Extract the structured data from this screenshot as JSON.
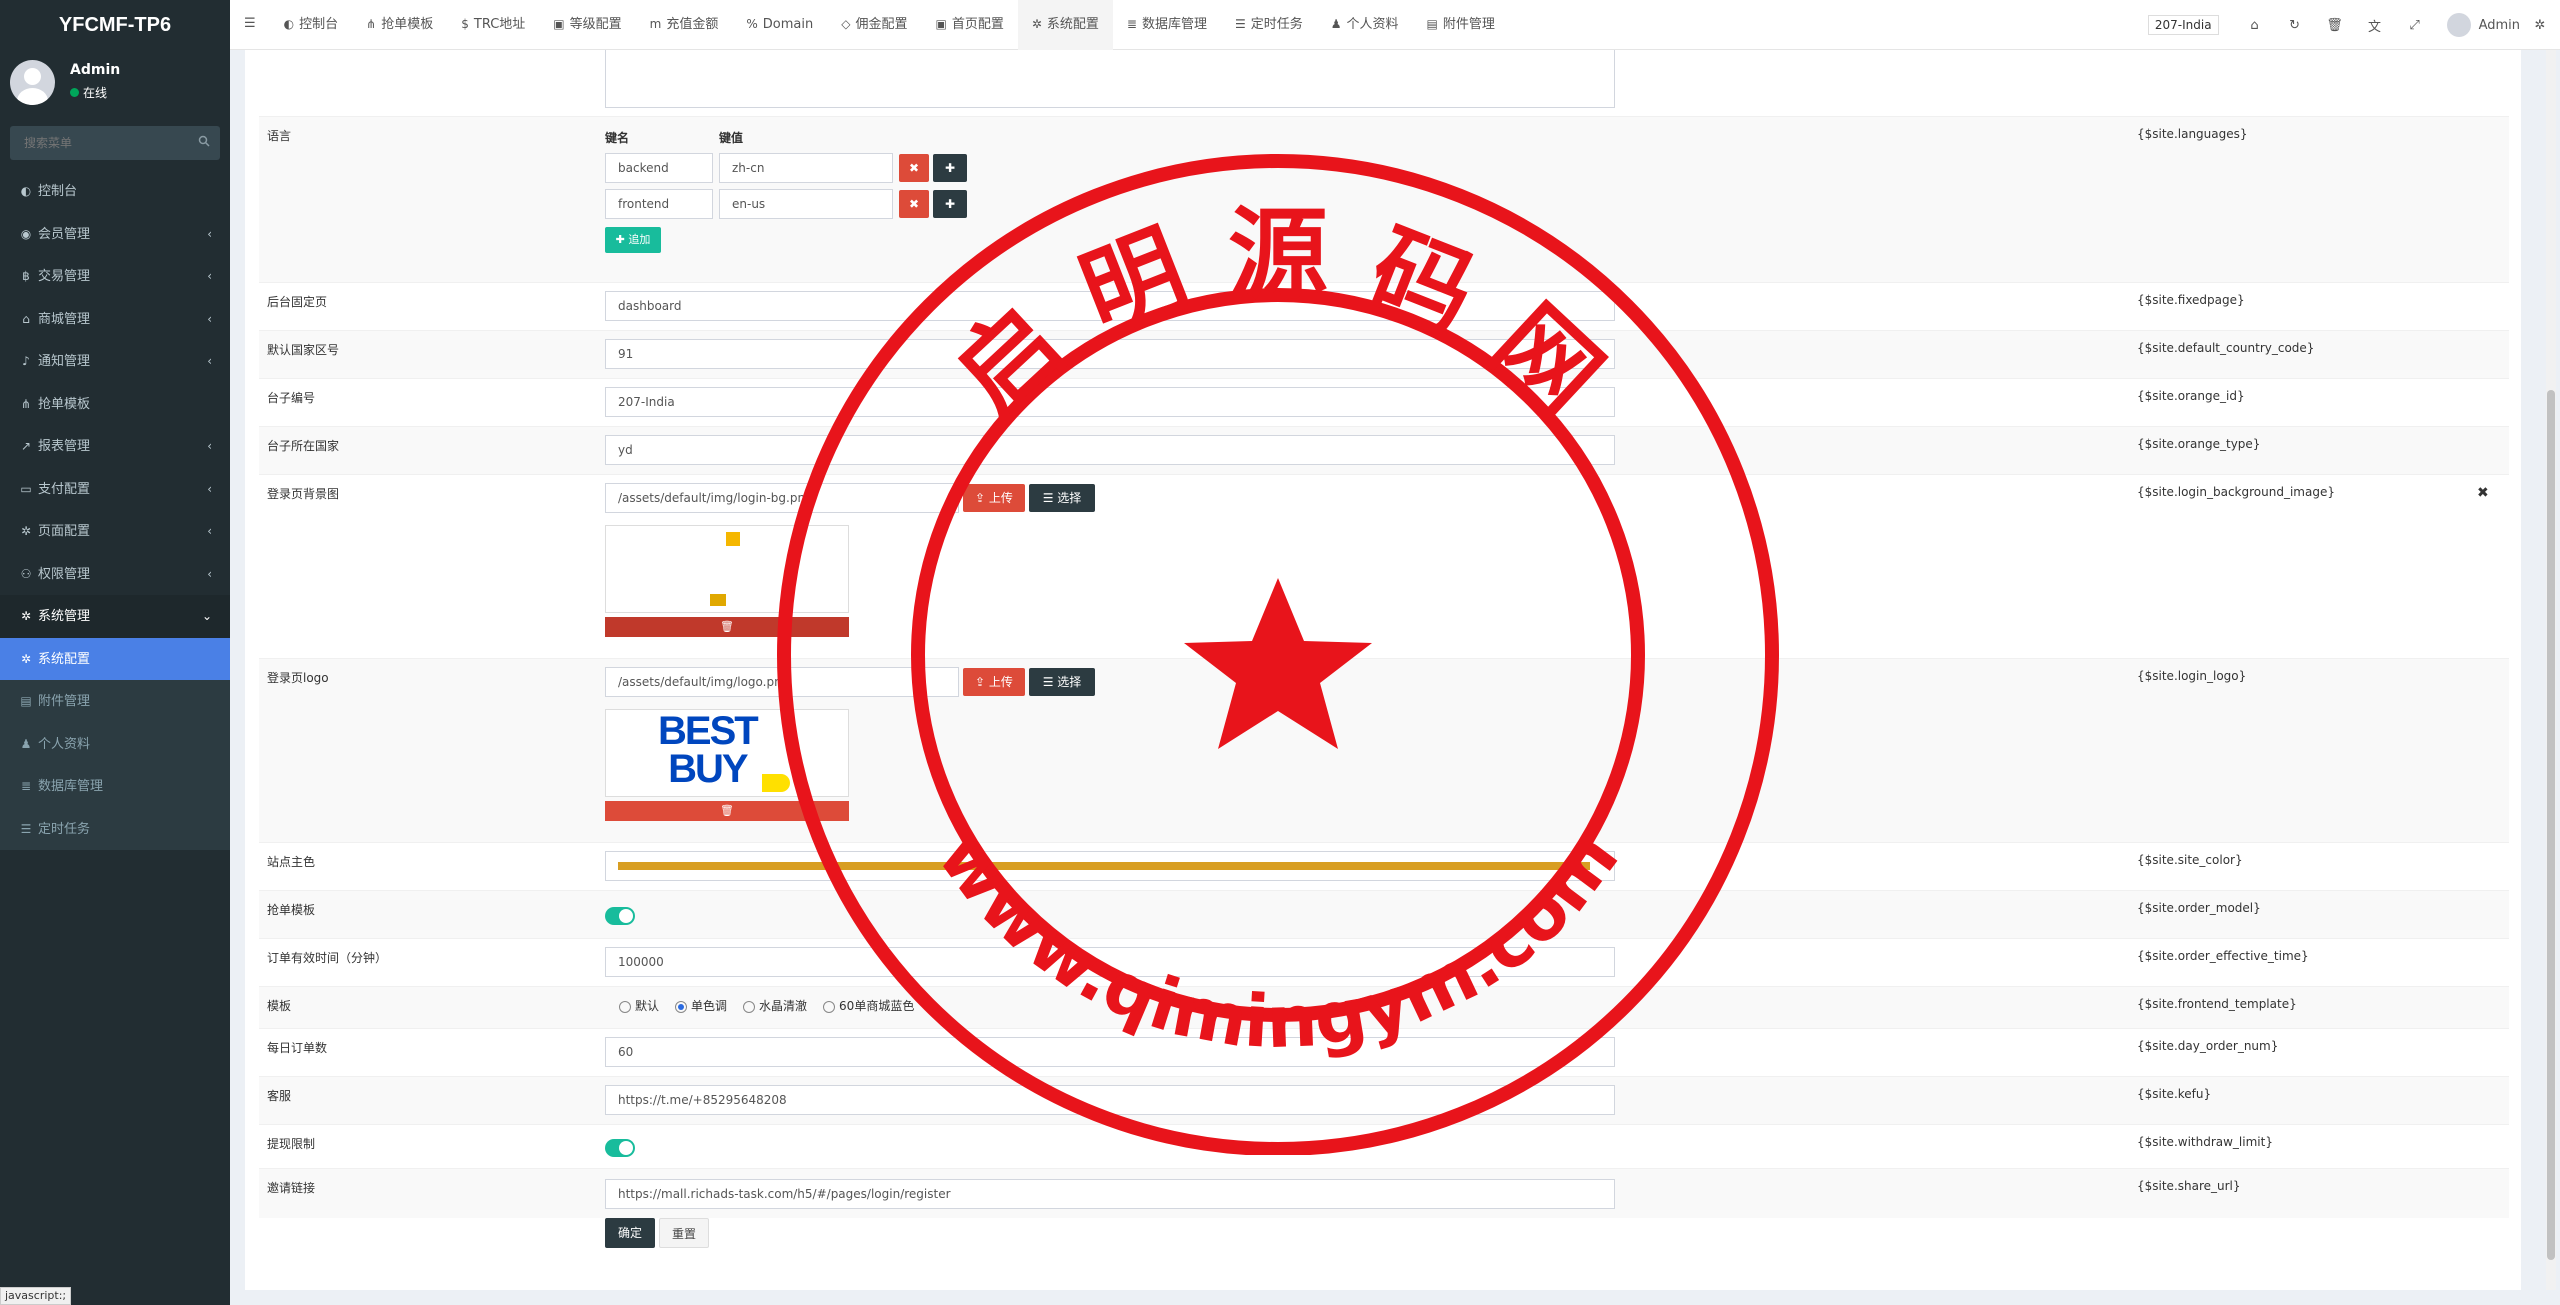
{
  "sidebar": {
    "logo": "YFCMF-TP6",
    "user": {
      "name": "Admin",
      "status": "在线"
    },
    "search_placeholder": "搜索菜单",
    "menu": [
      {
        "label": "控制台",
        "icon": "dashboard-icon",
        "glyph": "◐",
        "arrow": ""
      },
      {
        "label": "会员管理",
        "icon": "user-circle-icon",
        "glyph": "◉",
        "arrow": "‹"
      },
      {
        "label": "交易管理",
        "icon": "bitcoin-icon",
        "glyph": "฿",
        "arrow": "‹"
      },
      {
        "label": "商城管理",
        "icon": "home-icon",
        "glyph": "⌂",
        "arrow": "‹"
      },
      {
        "label": "通知管理",
        "icon": "bell-icon",
        "glyph": "♪",
        "arrow": "‹"
      },
      {
        "label": "抢单模板",
        "icon": "sitemap-icon",
        "glyph": "⋔",
        "arrow": ""
      },
      {
        "label": "报表管理",
        "icon": "chart-icon",
        "glyph": "↗",
        "arrow": "‹"
      },
      {
        "label": "支付配置",
        "icon": "credit-card-icon",
        "glyph": "▭",
        "arrow": "‹"
      },
      {
        "label": "页面配置",
        "icon": "gear-icon",
        "glyph": "✲",
        "arrow": "‹"
      },
      {
        "label": "权限管理",
        "icon": "users-icon",
        "glyph": "⚇",
        "arrow": "‹"
      },
      {
        "label": "系统管理",
        "icon": "cogs-icon",
        "glyph": "✲",
        "arrow": "⌄"
      },
      {
        "label": "系统配置",
        "icon": "gear-icon",
        "glyph": "✲",
        "arrow": ""
      },
      {
        "label": "附件管理",
        "icon": "file-image-icon",
        "glyph": "▤",
        "arrow": ""
      },
      {
        "label": "个人资料",
        "icon": "user-icon",
        "glyph": "♟",
        "arrow": ""
      },
      {
        "label": "数据库管理",
        "icon": "database-icon",
        "glyph": "≣",
        "arrow": ""
      },
      {
        "label": "定时任务",
        "icon": "list-icon",
        "glyph": "☰",
        "arrow": ""
      }
    ]
  },
  "topbar": {
    "tabs": [
      {
        "label": "控制台",
        "glyph": "◐"
      },
      {
        "label": "抢单模板",
        "glyph": "⋔"
      },
      {
        "label": "TRC地址",
        "glyph": "$"
      },
      {
        "label": "等级配置",
        "glyph": "▣"
      },
      {
        "label": "充值金额",
        "glyph": "m"
      },
      {
        "label": "Domain",
        "glyph": "%"
      },
      {
        "label": "佣金配置",
        "glyph": "◇"
      },
      {
        "label": "首页配置",
        "glyph": "▣"
      },
      {
        "label": "系统配置",
        "glyph": "✲"
      },
      {
        "label": "数据库管理",
        "glyph": "≣"
      },
      {
        "label": "定时任务",
        "glyph": "☰"
      },
      {
        "label": "个人资料",
        "glyph": "♟"
      },
      {
        "label": "附件管理",
        "glyph": "▤"
      }
    ],
    "site_badge": "207-India",
    "admin": "Admin"
  },
  "form": {
    "languages": {
      "label": "语言",
      "key": "{$site.languages}",
      "col_key": "键名",
      "col_val": "键值",
      "rows": [
        {
          "k": "backend",
          "v": "zh-cn"
        },
        {
          "k": "frontend",
          "v": "en-us"
        }
      ],
      "add_label": "追加"
    },
    "fixedpage": {
      "label": "后台固定页",
      "value": "dashboard",
      "key": "{$site.fixedpage}"
    },
    "country_code": {
      "label": "默认国家区号",
      "value": "91",
      "key": "{$site.default_country_code}"
    },
    "orange_id": {
      "label": "台子编号",
      "value": "207-India",
      "key": "{$site.orange_id}"
    },
    "orange_type": {
      "label": "台子所在国家",
      "value": "yd",
      "key": "{$site.orange_type}"
    },
    "login_bg": {
      "label": "登录页背景图",
      "value": "/assets/default/img/login-bg.png",
      "key": "{$site.login_background_image}",
      "upload": "上传",
      "choose": "选择"
    },
    "login_logo": {
      "label": "登录页logo",
      "value": "/assets/default/img/logo.png",
      "key": "{$site.login_logo}",
      "upload": "上传",
      "choose": "选择",
      "logo_line1": "BEST",
      "logo_line2": "BUY"
    },
    "site_color": {
      "label": "站点主色",
      "key": "{$site.site_color}",
      "color": "#d89e22"
    },
    "order_model": {
      "label": "抢单模板",
      "key": "{$site.order_model}",
      "on": true
    },
    "order_time": {
      "label": "订单有效时间（分钟）",
      "value": "100000",
      "key": "{$site.order_effective_time}"
    },
    "template": {
      "label": "模板",
      "key": "{$site.frontend_template}",
      "options": [
        "默认",
        "单色调",
        "水晶清澈",
        "60单商城蓝色"
      ],
      "selected": 1
    },
    "day_order": {
      "label": "每日订单数",
      "value": "60",
      "key": "{$site.day_order_num}"
    },
    "kefu": {
      "label": "客服",
      "value": "https://t.me/+85295648208",
      "key": "{$site.kefu}"
    },
    "withdraw": {
      "label": "提现限制",
      "key": "{$site.withdraw_limit}",
      "on": true
    },
    "share_url": {
      "label": "邀请链接",
      "value": "https://mall.richads-task.com/h5/#/pages/login/register",
      "key": "{$site.share_url}"
    },
    "submit": "确定",
    "reset": "重置"
  },
  "watermark": {
    "top_text": "启 明 源 码 网",
    "bottom_text": "www.qimingym.com",
    "color": "#e8141b"
  },
  "status_tip": "javascript:;"
}
